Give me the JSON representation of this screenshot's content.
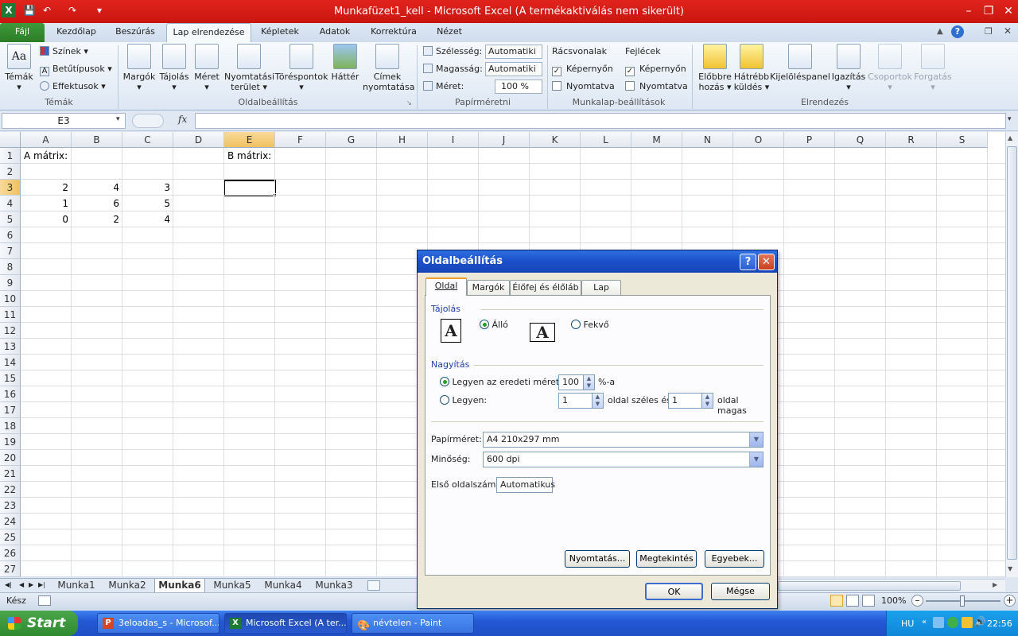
{
  "window": {
    "title": "Munkafüzet1_kell  -  Microsoft Excel (A termékaktiválás nem sikerült)"
  },
  "ribbon_tabs": [
    "Fájl",
    "Kezdőlap",
    "Beszúrás",
    "Lap elrendezése",
    "Képletek",
    "Adatok",
    "Korrektúra",
    "Nézet"
  ],
  "ribbon": {
    "themes": {
      "big": "Témák",
      "colors": "Színek",
      "fonts": "Betűtípusok",
      "effects": "Effektusok",
      "group": "Témák"
    },
    "page_setup": {
      "margins": "Margók",
      "orientation": "Tájolás",
      "size": "Méret",
      "print_area_1": "Nyomtatási",
      "print_area_2": "terület",
      "breaks": "Töréspontok",
      "background": "Háttér",
      "print_titles_1": "Címek",
      "print_titles_2": "nyomtatása",
      "group": "Oldalbeállítás"
    },
    "scale": {
      "width_label": "Szélesség:",
      "width_value": "Automatiki",
      "height_label": "Magasság:",
      "height_value": "Automatiki",
      "scale_label": "Méret:",
      "scale_value": "100 %",
      "group": "Papírméretni"
    },
    "sheet_options": {
      "gridlines": "Rácsvonalak",
      "headings": "Fejlécek",
      "view1": "Képernyőn",
      "print1": "Nyomtatva",
      "view2": "Képernyőn",
      "print2": "Nyomtatva",
      "group": "Munkalap-beállítások"
    },
    "arrange": {
      "bring_1": "Előbbre",
      "bring_2": "hozás",
      "send_1": "Hátrébb",
      "send_2": "küldés",
      "selection": "Kijelöléspanel",
      "align": "Igazítás",
      "group_btn": "Csoportok",
      "rotate": "Forgatás",
      "group": "Elrendezés"
    }
  },
  "formula_bar": {
    "name_box": "E3",
    "fx": "fx",
    "formula": ""
  },
  "columns": [
    "A",
    "B",
    "C",
    "D",
    "E",
    "F",
    "G",
    "H",
    "I",
    "J",
    "K",
    "L",
    "M",
    "N",
    "O",
    "P",
    "Q",
    "R",
    "S"
  ],
  "rows": [
    "1",
    "2",
    "3",
    "4",
    "5",
    "6",
    "7",
    "8",
    "9",
    "10",
    "11",
    "12",
    "13",
    "14",
    "15",
    "16",
    "17",
    "18",
    "19",
    "20",
    "21",
    "22",
    "23",
    "24",
    "25",
    "26",
    "27"
  ],
  "cells": {
    "A1": "A mátrix:",
    "E1": "B mátrix:",
    "A3": "2",
    "B3": "4",
    "C3": "3",
    "A4": "1",
    "B4": "6",
    "C4": "5",
    "A5": "0",
    "B5": "2",
    "C5": "4"
  },
  "sheet_tabs": [
    "Munka1",
    "Munka2",
    "Munka6",
    "Munka5",
    "Munka4",
    "Munka3"
  ],
  "active_sheet": "Munka6",
  "status": {
    "ready": "Kész",
    "zoom": "100%"
  },
  "dialog": {
    "title": "Oldalbeállítás",
    "help": "?",
    "tabs": [
      "Oldal",
      "Margók",
      "Élőfej és élőláb",
      "Lap"
    ],
    "orientation_label": "Tájolás",
    "portrait": "Álló",
    "landscape": "Fekvő",
    "scaling_label": "Nagyítás",
    "adjust_label": "Legyen az eredeti méret:",
    "adjust_value": "100",
    "adjust_unit": "%-a",
    "fit_label": "Legyen:",
    "fit_wide_value": "1",
    "fit_wide_label": "oldal széles és",
    "fit_tall_value": "1",
    "fit_tall_label": "oldal magas",
    "paper_size_label": "Papírméret:",
    "paper_size_value": "A4 210x297 mm",
    "quality_label": "Minőség:",
    "quality_value": "600 dpi",
    "first_page_label": "Első oldalszám:",
    "first_page_value": "Automatikus",
    "print_btn": "Nyomtatás...",
    "preview_btn": "Megtekintés",
    "options_btn": "Egyebek...",
    "ok_btn": "OK",
    "cancel_btn": "Mégse"
  },
  "taskbar": {
    "start": "Start",
    "tasks": [
      "3eloadas_s - Microsof...",
      "Microsoft Excel (A ter...",
      "névtelen - Paint"
    ],
    "lang": "HU",
    "clock": "22:56"
  },
  "colors": {
    "title_red": "#d11c16",
    "excel_green": "#2b7c26",
    "xp_blue": "#2458d5"
  }
}
